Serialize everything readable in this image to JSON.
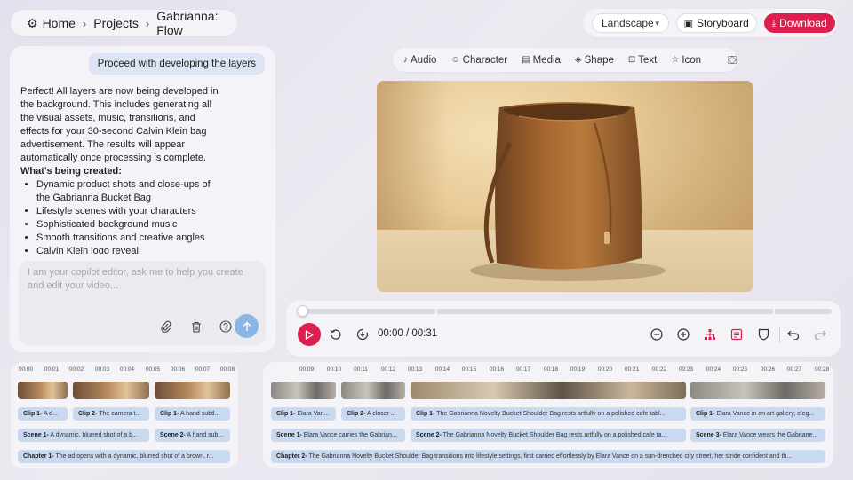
{
  "breadcrumb": {
    "home": "Home",
    "projects": "Projects",
    "current": "Gabrianna: Flow",
    "separator": "›"
  },
  "header": {
    "aspect_select": "Landscape",
    "storyboard_label": "Storyboard",
    "download_label": "Download"
  },
  "chat": {
    "user_message": "Proceed with developing the layers",
    "assistant_paragraph": "Perfect! All layers are now being developed in the background. This includes generating all the visual assets, music, transitions, and effects for your 30-second Calvin Klein bag advertisement. The results will appear automatically once processing is complete.",
    "assistant_heading": "What's being created:",
    "bullets": [
      "Dynamic product shots and close-ups of the Gabrianna Bucket Bag",
      "Lifestyle scenes with your characters",
      "Sophisticated background music",
      "Smooth transitions and creative angles",
      "Calvin Klein logo reveal"
    ],
    "composer_placeholder": "I am your copilot editor, ask me to help you create and edit your video..."
  },
  "insert_toolbar": {
    "audio": "Audio",
    "character": "Character",
    "media": "Media",
    "shape": "Shape",
    "text": "Text",
    "icon": "Icon"
  },
  "player": {
    "timecode": "00:00 / 00:31",
    "progress": 0.0
  },
  "timeline_left": {
    "ruler": [
      "00:00",
      "00:01",
      "00:02",
      "00:03",
      "00:04",
      "00:05",
      "00:06",
      "00:07",
      "00:08"
    ],
    "clips": [
      {
        "prefix": "Clip 1-",
        "text": "A d..."
      },
      {
        "prefix": "Clip 2-",
        "text": "The camera t..."
      },
      {
        "prefix": "Clip 1-",
        "text": "A hand subtl..."
      }
    ],
    "scenes": [
      {
        "prefix": "Scene 1-",
        "text": "A dynamic, blurred shot of a b..."
      },
      {
        "prefix": "Scene 2-",
        "text": "A hand subtl..."
      }
    ],
    "chapter": {
      "prefix": "Chapter 1-",
      "text": "The ad opens with a dynamic, blurred shot of a brown, r..."
    }
  },
  "timeline_right": {
    "ruler": [
      "00:09",
      "00:10",
      "00:11",
      "00:12",
      "00:13",
      "00:14",
      "00:15",
      "00:16",
      "00:17",
      "00:18",
      "00:19",
      "00:20",
      "00:21",
      "00:22",
      "00:23",
      "00:24",
      "00:25",
      "00:26",
      "00:27",
      "00:28"
    ],
    "clips": [
      {
        "prefix": "Clip 1-",
        "text": "Elara Van..."
      },
      {
        "prefix": "Clip 2-",
        "text": "A closer ..."
      },
      {
        "prefix": "Clip 1-",
        "text": "The Gabrianna Novelty Bucket Shoulder Bag rests artfully on a polished cafe tabl..."
      },
      {
        "prefix": "Clip 1-",
        "text": "Elara Vance in an art gallery, eleg..."
      }
    ],
    "scenes": [
      {
        "prefix": "Scene 1-",
        "text": "Elara Vance carries the Gabrian..."
      },
      {
        "prefix": "Scene 2-",
        "text": "The Gabrianna Novelty Bucket Shoulder Bag rests artfully on a polished cafe ta..."
      },
      {
        "prefix": "Scene 3-",
        "text": "Elara Vance wears the Gabriane..."
      }
    ],
    "chapter": {
      "prefix": "Chapter 2-",
      "text": "The Gabrianna Novelty Bucket Shoulder Bag transitions into lifestyle settings, first carried effortlessly by Elara Vance on a sun-drenched city street, her stride confident and th..."
    }
  },
  "colors": {
    "accent": "#dc1f4e",
    "send": "#8bb6e4",
    "tag": "#c9daf0"
  }
}
